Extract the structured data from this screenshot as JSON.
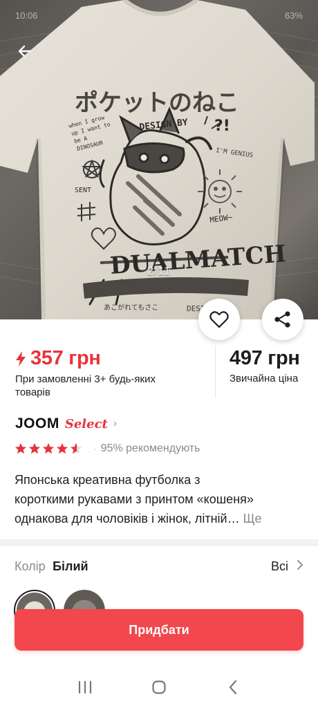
{
  "status_bar": {
    "time": "10:06",
    "battery": "63%"
  },
  "gallery": {
    "counter": "2/11"
  },
  "shirt_print": {
    "jp_title": "ポケットのねこ",
    "design_by": "DESIGN BY",
    "text_grow": "when I grow up I want to be a DINOSAUR",
    "im_genius": "I'M GENIUS",
    "meow": "MEOW~",
    "sent": "SENT",
    "main_word": "DUALMATCH",
    "small_jp": "あこがれてもさこ"
  },
  "price": {
    "sale": "357 грн",
    "sale_note": "При замовленні 3+ будь-яких товарів",
    "regular": "497 грн",
    "regular_note": "Звичайна ціна"
  },
  "brand": {
    "name": "JOOM",
    "badge": "Select"
  },
  "rating": {
    "stars": 4.5,
    "recommend": "95% рекомендують"
  },
  "title": {
    "line1": "Японська креативна футболка з",
    "line2": "короткими рукавами з принтом «кошеня»",
    "line3": "однакова для чоловіків і жінок, літній…",
    "more": "Ще"
  },
  "color": {
    "label": "Колір",
    "value": "Білий",
    "all": "Всі"
  },
  "buy_button": "Придбати",
  "colors": {
    "accent": "#e8333c",
    "button": "#f1474d",
    "text": "#1e1e1e",
    "muted": "#8a8a8a"
  }
}
